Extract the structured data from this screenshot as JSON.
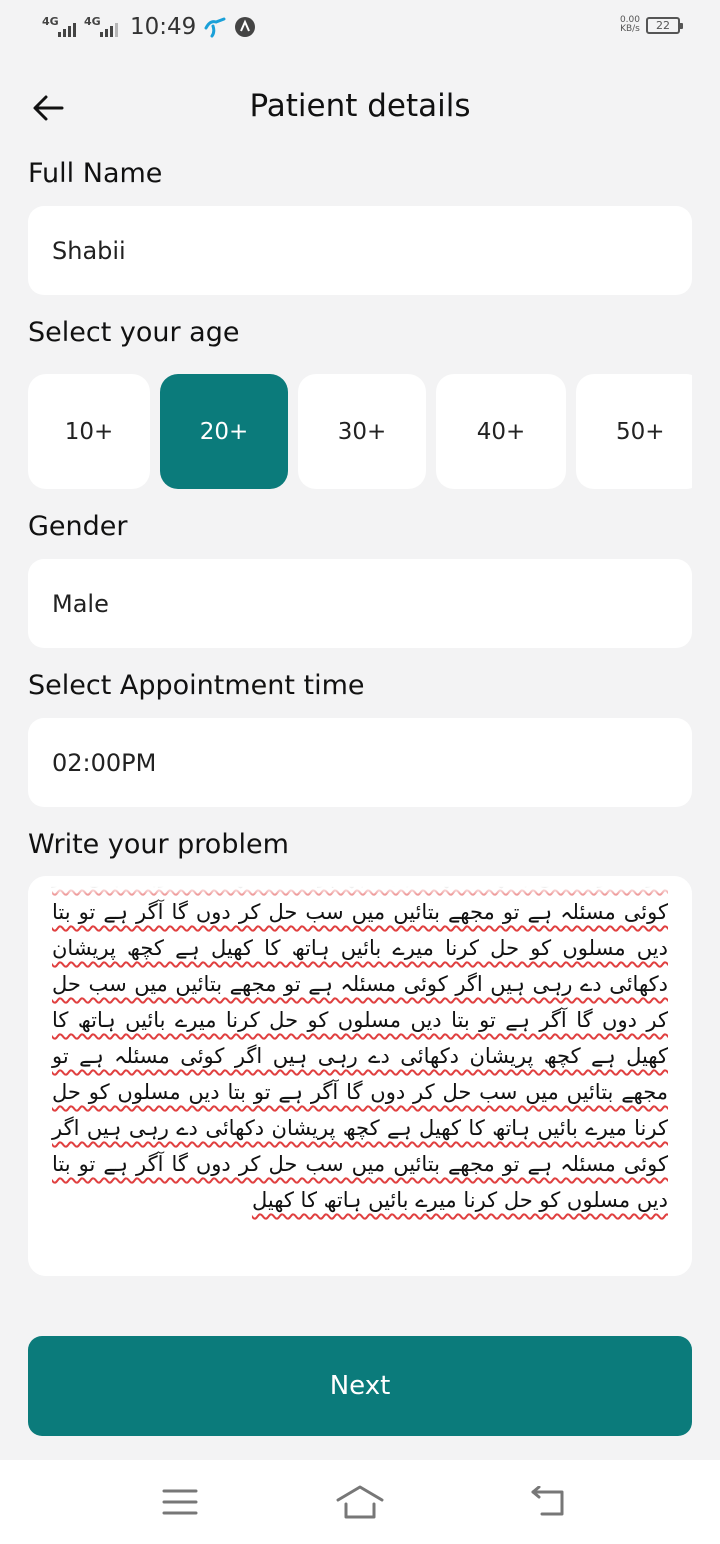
{
  "status_bar": {
    "network_1": "4G",
    "network_2": "4G",
    "time": "10:49",
    "speed_value": "0.00",
    "speed_unit": "KB/s",
    "battery": "22"
  },
  "header": {
    "title": "Patient details",
    "back_icon": "arrow-left-icon"
  },
  "full_name": {
    "label": "Full Name",
    "value": "Shabii"
  },
  "age": {
    "label": "Select your age",
    "options": [
      "10+",
      "20+",
      "30+",
      "40+",
      "50+"
    ],
    "selected": "20+"
  },
  "gender": {
    "label": "Gender",
    "value": "Male"
  },
  "appointment": {
    "label": "Select Appointment time",
    "value": "02:00PM"
  },
  "problem": {
    "label": "Write your problem",
    "text": "کرنا میرے بائیں ہاتھ کا کھیل ہے کچھ پریشان دکھائی دے رہی ہیں اگر کوئی مسئلہ ہے تو مجھے بتائیں میں سب حل کر دوں گا آگر ہے تو بتا دیں مسلوں کو حل کرنا میرے بائیں ہاتھ کا کھیل ہے کچھ پریشان دکھائی دے رہی ہیں اگر کوئی مسئلہ ہے تو مجھے بتائیں میں سب حل کر دوں گا آگر ہے تو بتا دیں مسلوں کو حل کرنا میرے بائیں ہاتھ کا کھیل ہے کچھ پریشان دکھائی دے رہی ہیں اگر کوئی مسئلہ ہے تو مجھے بتائیں میں سب حل کر دوں گا آگر ہے تو بتا دیں مسلوں کو حل کرنا میرے بائیں ہاتھ کا کھیل ہے کچھ پریشان دکھائی دے رہی ہیں اگر کوئی مسئلہ ہے تو مجھے بتائیں میں سب حل کر دوں گا آگر ہے تو بتا دیں مسلوں کو حل کرنا میرے بائیں ہاتھ کا کھیل"
  },
  "next_button": {
    "label": "Next"
  },
  "colors": {
    "accent": "#0b7b7b",
    "background": "#f3f3f4",
    "spellcheck": "#e04040"
  },
  "nav_icons": [
    "menu-icon",
    "home-icon",
    "back-icon"
  ]
}
